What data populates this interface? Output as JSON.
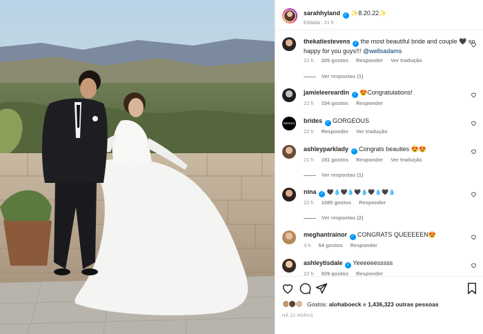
{
  "post": {
    "username": "sarahhyland",
    "caption": "✨8.20.22✨",
    "edited": "Editada · 21 h"
  },
  "comments": [
    {
      "username": "thekatiestevens",
      "verified": true,
      "text": "the most beautiful bride and couple 🖤 so",
      "text2": "happy for you guys!!!",
      "mention": "@wellsadams",
      "time": "21 h",
      "likes": "205 gostos",
      "reply": "Responder",
      "translate": "Ver tradução",
      "replies": "Ver respostas (1)"
    },
    {
      "username": "jamieleereardin",
      "verified": true,
      "text": "😍Congratulations!",
      "time": "22 h",
      "likes": "104 gostos",
      "reply": "Responder"
    },
    {
      "username": "brides",
      "verified": true,
      "text": "GORGEOUS",
      "time": "22 h",
      "likes": "",
      "reply": "Responder",
      "translate": "Ver tradução",
      "avatar_text": "BRIDES"
    },
    {
      "username": "ashleyparklady",
      "verified": true,
      "text": "Congrats beauties 😍😍",
      "time": "21 h",
      "likes": "191 gostos",
      "reply": "Responder",
      "translate": "Ver tradução",
      "replies": "Ver respostas (1)"
    },
    {
      "username": "nina",
      "verified": true,
      "text": "🖤💧🖤💧🖤💧🖤💧🖤💧",
      "time": "22 h",
      "likes": "1085 gostos",
      "reply": "Responder",
      "replies": "Ver respostas (2)"
    },
    {
      "username": "meghantrainor",
      "verified": true,
      "text": "CONGRATS QUEEEEEN😍",
      "time": "3 h",
      "likes": "54 gostos",
      "reply": "Responder"
    },
    {
      "username": "ashleytisdale",
      "verified": true,
      "text": "Yeeeeeesssss",
      "time": "22 h",
      "likes": "929 gostos",
      "reply": "Responder"
    }
  ],
  "footer": {
    "likes_prefix": "Gostos:",
    "likes_user": "alohaboeck",
    "likes_joiner": "e",
    "likes_count": "1,436,323 outras pessoas",
    "date": "HÁ 22 HORAS"
  },
  "icons": {
    "like": "heart-icon",
    "comment": "comment-icon",
    "share": "share-icon",
    "save": "bookmark-icon",
    "verified": "verified-badge-icon"
  },
  "colors": {
    "accent_blue": "#0095f6",
    "text_primary": "#262626",
    "text_secondary": "#8e8e8e",
    "border": "#efefef"
  }
}
